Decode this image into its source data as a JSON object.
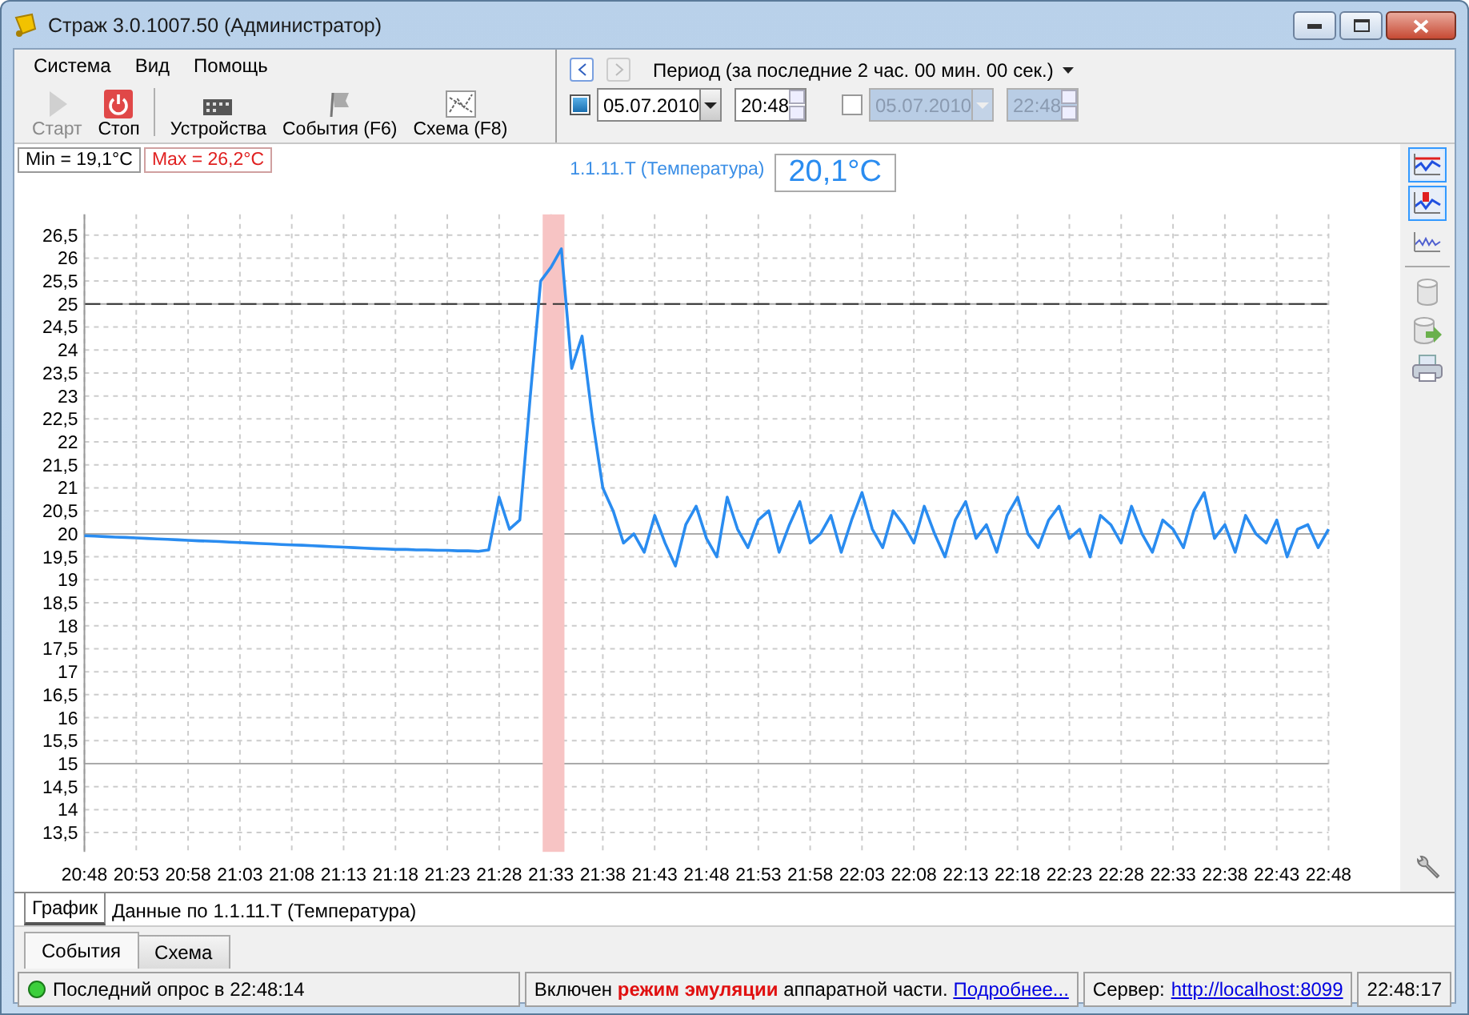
{
  "window": {
    "title": "Страж 3.0.1007.50 (Администратор)"
  },
  "menu": [
    {
      "label": "Система"
    },
    {
      "label": "Вид"
    },
    {
      "label": "Помощь"
    }
  ],
  "toolbar": [
    {
      "kind": "play",
      "label": "Старт",
      "disabled": true
    },
    {
      "kind": "stop",
      "label": "Стоп",
      "disabled": false
    },
    {
      "kind": "devices",
      "label": "Устройства",
      "disabled": false
    },
    {
      "kind": "events",
      "label": "События (F6)",
      "disabled": false
    },
    {
      "kind": "scheme",
      "label": "Схема (F8)",
      "disabled": false
    }
  ],
  "period": {
    "label": "Период (за последние 2 час. 00 мин. 00 сек.)",
    "prev_disabled": false,
    "next_disabled": true
  },
  "range": [
    {
      "checked": true,
      "disabled": false,
      "date": "05.07.2010",
      "time": "20:48"
    },
    {
      "checked": false,
      "disabled": true,
      "date": "05.07.2010",
      "time": "22:48"
    }
  ],
  "chart": {
    "min_label": "Min = 19,1°C",
    "max_label": "Max = 26,2°C",
    "current_value": "20,1°C",
    "chart_data": {
      "type": "line",
      "categories": [
        "20:48",
        null,
        null,
        null,
        null,
        "20:53",
        null,
        null,
        null,
        null,
        "20:58",
        null,
        null,
        null,
        null,
        "21:03",
        null,
        null,
        null,
        null,
        "21:08",
        null,
        null,
        null,
        null,
        "21:13",
        null,
        null,
        null,
        null,
        "21:18",
        null,
        null,
        null,
        null,
        "21:23",
        null,
        null,
        null,
        null,
        "21:28",
        null,
        null,
        null,
        null,
        "21:33",
        null,
        null,
        null,
        null,
        "21:38",
        null,
        null,
        null,
        null,
        "21:43",
        null,
        null,
        null,
        null,
        "21:48",
        null,
        null,
        null,
        null,
        "21:53",
        null,
        null,
        null,
        null,
        "21:58",
        null,
        null,
        null,
        null,
        "22:03",
        null,
        null,
        null,
        null,
        "22:08",
        null,
        null,
        null,
        null,
        "22:13",
        null,
        null,
        null,
        null,
        "22:18",
        null,
        null,
        null,
        null,
        "22:23",
        null,
        null,
        null,
        null,
        "22:28",
        null,
        null,
        null,
        null,
        "22:33",
        null,
        null,
        null,
        null,
        "22:38",
        null,
        null,
        null,
        null,
        "22:43",
        null,
        null,
        null,
        null,
        "22:48"
      ],
      "series": [
        {
          "name": "1.1.11.T (Температура)",
          "color": "#2a8cf0",
          "values": [
            19.96,
            19.95,
            19.94,
            19.93,
            19.92,
            19.91,
            19.9,
            19.89,
            19.88,
            19.87,
            19.86,
            19.85,
            19.84,
            19.83,
            19.82,
            19.81,
            19.8,
            19.79,
            19.78,
            19.77,
            19.76,
            19.75,
            19.74,
            19.73,
            19.72,
            19.71,
            19.7,
            19.69,
            19.68,
            19.67,
            19.66,
            19.66,
            19.65,
            19.65,
            19.64,
            19.64,
            19.63,
            19.63,
            19.62,
            19.65,
            20.8,
            20.1,
            20.3,
            23,
            25.5,
            25.8,
            26.2,
            23.6,
            24.3,
            22.5,
            21,
            20.5,
            19.8,
            20.0,
            19.6,
            20.4,
            19.8,
            19.3,
            20.2,
            20.6,
            19.9,
            19.5,
            20.8,
            20.1,
            19.7,
            20.3,
            20.5,
            19.6,
            20.2,
            20.7,
            19.8,
            20.0,
            20.4,
            19.6,
            20.3,
            20.9,
            20.1,
            19.7,
            20.5,
            20.2,
            19.8,
            20.6,
            20.0,
            19.5,
            20.3,
            20.7,
            19.9,
            20.2,
            19.6,
            20.4,
            20.8,
            20.0,
            19.7,
            20.3,
            20.6,
            19.9,
            20.1,
            19.5,
            20.4,
            20.2,
            19.8,
            20.6,
            20.0,
            19.6,
            20.3,
            20.1,
            19.7,
            20.5,
            20.9,
            19.9,
            20.2,
            19.6,
            20.4,
            20.0,
            19.8,
            20.3,
            19.5,
            20.1,
            20.2,
            19.7,
            20.1
          ]
        }
      ],
      "ylim": [
        13.08,
        26.95
      ],
      "yticks": [
        {
          "value": 13.5,
          "label": "13,5"
        },
        {
          "value": 14,
          "label": "14"
        },
        {
          "value": 14.5,
          "label": "14,5"
        },
        {
          "value": 15,
          "label": "15"
        },
        {
          "value": 15.5,
          "label": "15,5"
        },
        {
          "value": 16,
          "label": "16"
        },
        {
          "value": 16.5,
          "label": "16,5"
        },
        {
          "value": 17,
          "label": "17"
        },
        {
          "value": 17.5,
          "label": "17,5"
        },
        {
          "value": 18,
          "label": "18"
        },
        {
          "value": 18.5,
          "label": "18,5"
        },
        {
          "value": 19,
          "label": "19"
        },
        {
          "value": 19.5,
          "label": "19,5"
        },
        {
          "value": 20,
          "label": "20"
        },
        {
          "value": 20.5,
          "label": "20,5"
        },
        {
          "value": 21,
          "label": "21"
        },
        {
          "value": 21.5,
          "label": "21,5"
        },
        {
          "value": 22,
          "label": "22"
        },
        {
          "value": 22.5,
          "label": "22,5"
        },
        {
          "value": 23,
          "label": "23"
        },
        {
          "value": 23.5,
          "label": "23,5"
        },
        {
          "value": 24,
          "label": "24"
        },
        {
          "value": 24.5,
          "label": "24,5"
        },
        {
          "value": 25,
          "label": "25"
        },
        {
          "value": 25.5,
          "label": "25,5"
        },
        {
          "value": 26,
          "label": "26"
        },
        {
          "value": 26.5,
          "label": "26,5"
        }
      ],
      "grid": true,
      "ref_lines": [
        {
          "axis": "y",
          "value": 25
        }
      ]
    }
  },
  "side_tools": [
    {
      "kind": "trend",
      "selected": true
    },
    {
      "kind": "marker",
      "selected": true
    },
    {
      "kind": "plain",
      "selected": false
    },
    {
      "kind": "database",
      "selected": false
    },
    {
      "kind": "export",
      "selected": false
    },
    {
      "kind": "print",
      "selected": false
    }
  ],
  "view_tabs": [
    {
      "label": "График",
      "selected": true
    },
    {
      "label": "Данные по 1.1.11.T (Температура)",
      "selected": false
    }
  ],
  "bottom_tabs": [
    {
      "label": "События",
      "selected": true
    },
    {
      "label": "Схема",
      "selected": false
    }
  ],
  "status": {
    "last_poll": "Последний опрос в 22:48:14",
    "emulation": "Включен **режим эмуляции** аппаратной части.",
    "details_link": "Подробнее...",
    "server_label": "Сервер:",
    "server_link": "http://localhost:8099",
    "time": "22:48:17"
  }
}
